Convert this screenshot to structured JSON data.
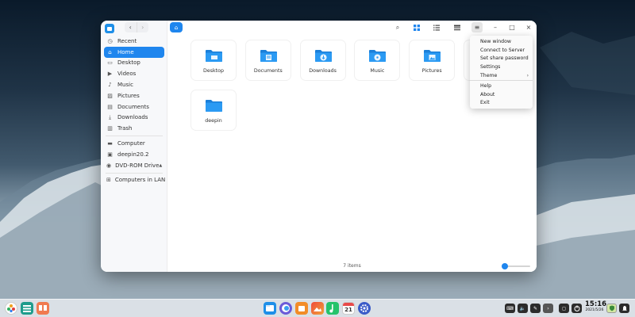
{
  "sidebar": {
    "items": [
      {
        "label": "Recent",
        "icon": "clock-icon"
      },
      {
        "label": "Home",
        "icon": "home-icon",
        "active": true
      },
      {
        "label": "Desktop",
        "icon": "desktop-icon"
      },
      {
        "label": "Videos",
        "icon": "video-icon"
      },
      {
        "label": "Music",
        "icon": "music-icon"
      },
      {
        "label": "Pictures",
        "icon": "picture-icon"
      },
      {
        "label": "Documents",
        "icon": "document-icon"
      },
      {
        "label": "Downloads",
        "icon": "download-icon"
      },
      {
        "label": "Trash",
        "icon": "trash-icon"
      }
    ],
    "devices": [
      {
        "label": "Computer",
        "icon": "computer-icon"
      },
      {
        "label": "deepin20.2",
        "icon": "disk-icon"
      },
      {
        "label": "DVD-ROM Drive",
        "icon": "dvd-icon",
        "eject": "▲"
      }
    ],
    "network": [
      {
        "label": "Computers in LAN",
        "icon": "network-icon"
      }
    ]
  },
  "toolbar": {
    "back": "‹",
    "forward": "›",
    "home_glyph": "⌂",
    "search_glyph": "⌕",
    "menu_glyph": "≡",
    "minimize_glyph": "–",
    "maximize_glyph": "□",
    "close_glyph": "×"
  },
  "files": [
    {
      "name": "Desktop",
      "icon": "desktop-folder-icon"
    },
    {
      "name": "Documents",
      "icon": "documents-folder-icon"
    },
    {
      "name": "Downloads",
      "icon": "downloads-folder-icon"
    },
    {
      "name": "Music",
      "icon": "music-folder-icon"
    },
    {
      "name": "Pictures",
      "icon": "pictures-folder-icon"
    },
    {
      "name": "deepin",
      "icon": "folder-icon"
    }
  ],
  "status": {
    "items_count": "7 items",
    "zoom_level": 0
  },
  "menu": {
    "items": [
      "New window",
      "Connect to Server",
      "Set share password",
      "Settings",
      "Theme",
      "Help",
      "About",
      "Exit"
    ],
    "theme_arrow": "›"
  },
  "taskbar": {
    "time": "15:16",
    "date": "2021/5/26",
    "calendar_day": "21",
    "tray_glyphs": [
      "⌨",
      "🔈",
      "✎",
      "›",
      "◻"
    ]
  },
  "colors": {
    "accent": "#1f86ee",
    "folder": "#2b9af3"
  }
}
